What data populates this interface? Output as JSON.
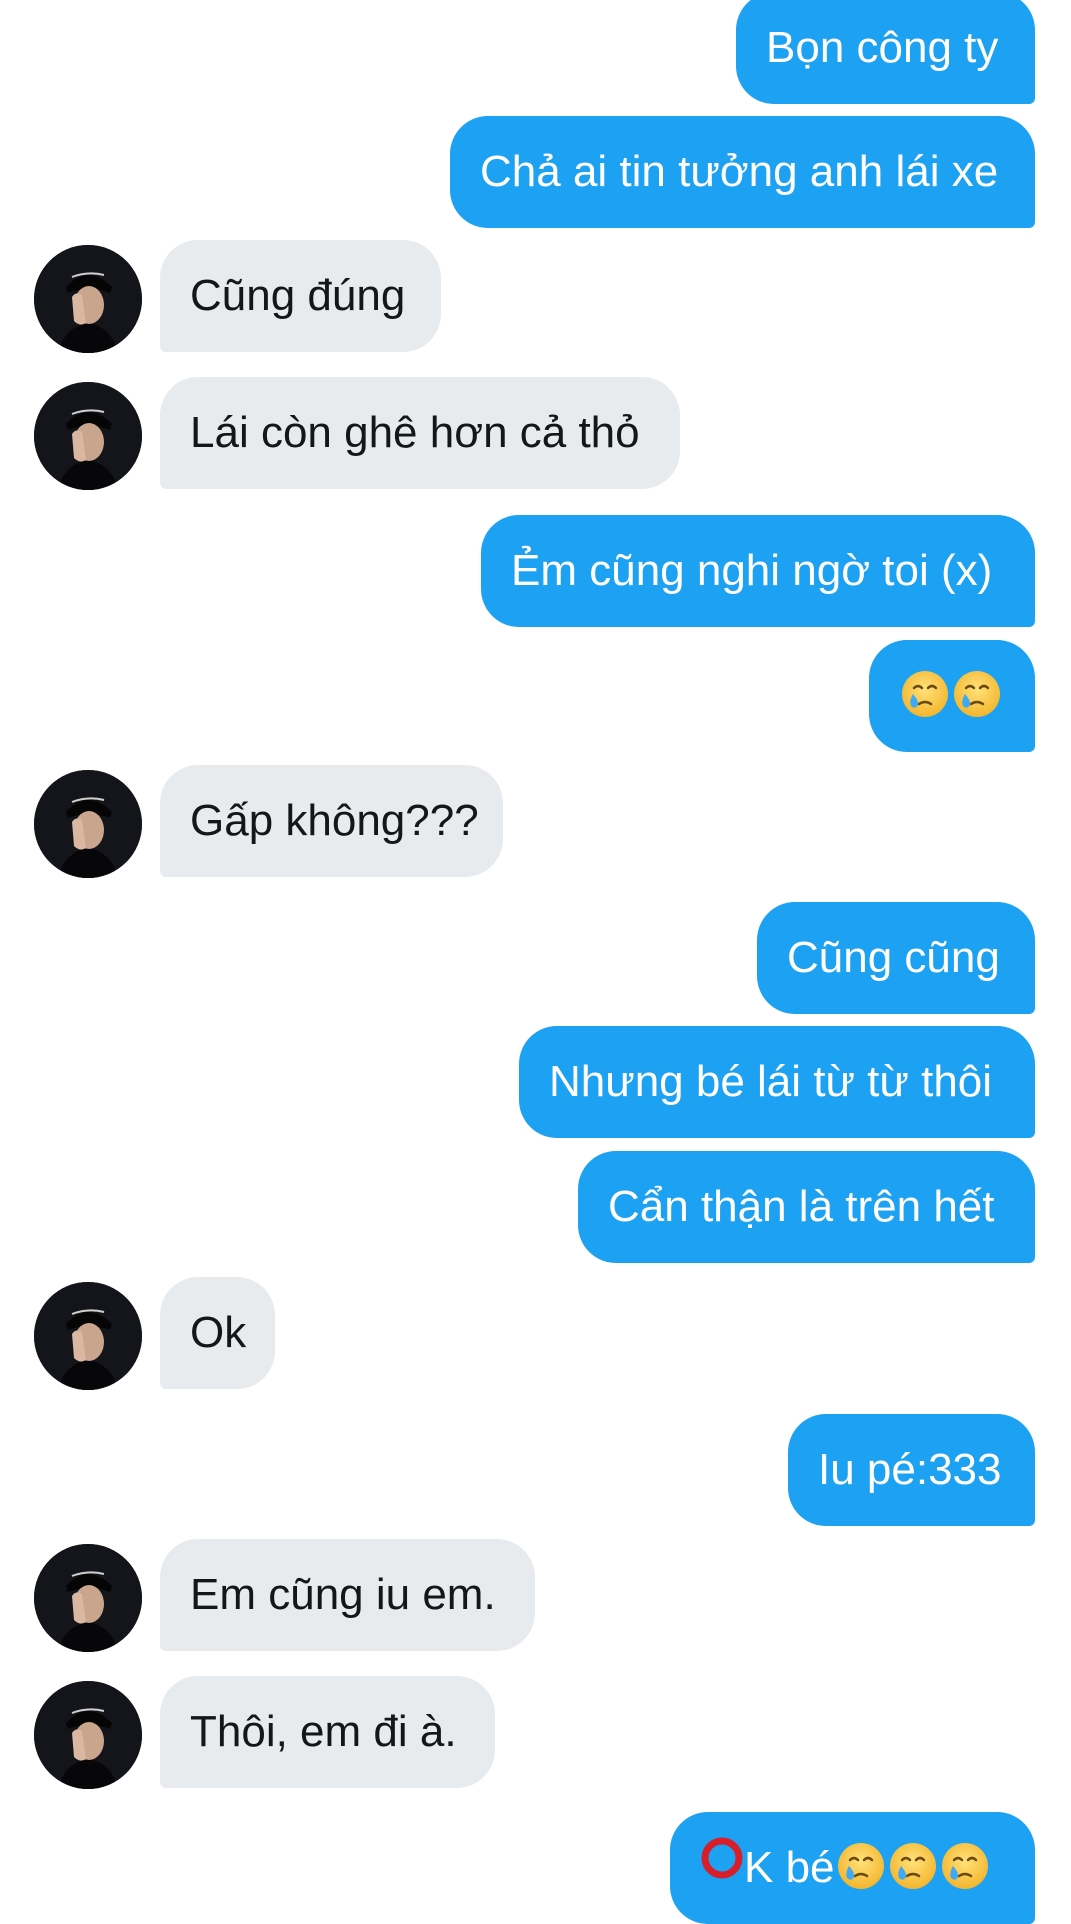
{
  "messages": [
    {
      "side": "sent",
      "text": "Bọn công ty"
    },
    {
      "side": "sent",
      "text": "Chả ai tin tưởng anh lái xe"
    },
    {
      "side": "received",
      "text": "Cũng đúng"
    },
    {
      "side": "received",
      "text": "Lái còn ghê hơn cả thỏ"
    },
    {
      "side": "sent",
      "text": "Ẻm cũng nghi ngờ toi (x)"
    },
    {
      "side": "sent",
      "text": "",
      "emoji_count": 2
    },
    {
      "side": "received",
      "text": "Gấp không???"
    },
    {
      "side": "sent",
      "text": "Cũng cũng"
    },
    {
      "side": "sent",
      "text": "Nhưng bé lái từ từ thôi"
    },
    {
      "side": "sent",
      "text": "Cẩn thận là trên hết"
    },
    {
      "side": "received",
      "text": "Ok"
    },
    {
      "side": "sent",
      "text": "Iu pé:333"
    },
    {
      "side": "received",
      "text": "Em cũng iu em."
    },
    {
      "side": "received",
      "text": "Thôi, em đi à."
    },
    {
      "side": "sent",
      "text": "K bé",
      "prefix_icon": "red-circle-icon",
      "emoji_count": 3
    }
  ],
  "emoji": "crying-face-icon",
  "colors": {
    "sent_bubble": "#1da1f2",
    "sent_text": "#ffffff",
    "received_bubble": "#e8ebee",
    "received_text": "#14171a",
    "background": "#ffffff"
  }
}
